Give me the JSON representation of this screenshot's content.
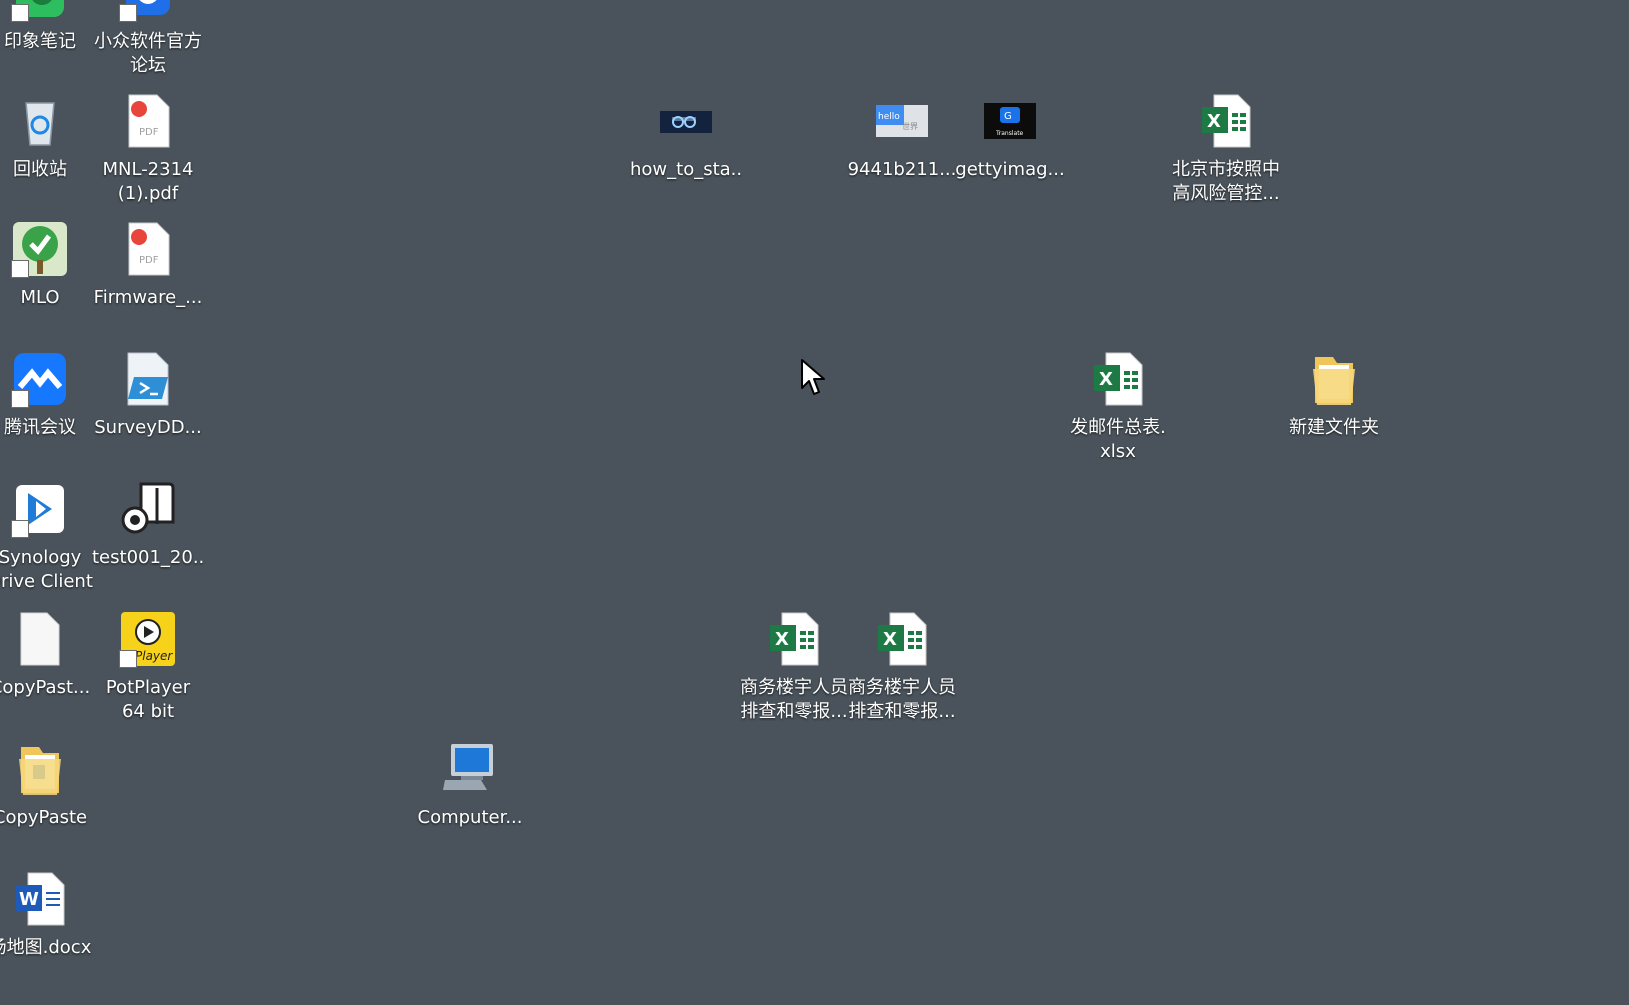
{
  "desktop": {
    "background_color": "#4a535b",
    "icons": [
      {
        "label": "印象笔记",
        "icon": "evernote-app-icon",
        "shortcut": true
      },
      {
        "label": "小众软件官方\n论坛",
        "icon": "browser-app-icon",
        "shortcut": true
      },
      {
        "label": "回收站",
        "icon": "recycle-bin-icon",
        "shortcut": false
      },
      {
        "label": "MNL-2314\n(1).pdf",
        "icon": "pdf-file-icon",
        "shortcut": false
      },
      {
        "label": "MLO",
        "icon": "mlo-app-icon",
        "shortcut": true
      },
      {
        "label": "Firmware_...",
        "icon": "pdf-file-icon",
        "shortcut": false
      },
      {
        "label": "腾讯会议",
        "icon": "tencent-meeting-icon",
        "shortcut": true
      },
      {
        "label": "SurveyDD...",
        "icon": "powershell-script-icon",
        "shortcut": false
      },
      {
        "label": "Synology\nDrive Client",
        "icon": "synology-drive-icon",
        "shortcut": true
      },
      {
        "label": "test001_20...",
        "icon": "audio-file-icon",
        "shortcut": false
      },
      {
        "label": "CopyPast...",
        "icon": "blank-file-icon",
        "shortcut": false
      },
      {
        "label": "PotPlayer\n64 bit",
        "icon": "potplayer-icon",
        "shortcut": true
      },
      {
        "label": "CopyPaste",
        "icon": "folder-icon",
        "shortcut": false
      },
      {
        "label": "场地图.docx",
        "icon": "word-document-icon",
        "shortcut": false
      },
      {
        "label": "Computer...",
        "icon": "computer-icon",
        "shortcut": false
      },
      {
        "label": "how_to_sta...",
        "icon": "image-thumbnail-icon",
        "shortcut": false
      },
      {
        "label": "9441b211...",
        "icon": "image-thumbnail-icon",
        "shortcut": false
      },
      {
        "label": "gettyimag...",
        "icon": "image-thumbnail-icon",
        "shortcut": false
      },
      {
        "label": "北京市按照中\n高风险管控...",
        "icon": "excel-file-icon",
        "shortcut": false
      },
      {
        "label": "发邮件总表.\nxlsx",
        "icon": "excel-file-icon",
        "shortcut": false
      },
      {
        "label": "新建文件夹",
        "icon": "folder-icon",
        "shortcut": false
      },
      {
        "label": "商务楼宇人员\n排查和零报...",
        "icon": "excel-file-icon",
        "shortcut": false
      },
      {
        "label": "商务楼宇人员\n排查和零报...",
        "icon": "excel-file-icon",
        "shortcut": false
      }
    ],
    "thumbnail_texts": {
      "hello_text": "hello",
      "world_text": "世界",
      "translate_text": "Translate",
      "player_text": "Player"
    },
    "cursor": "mouse-pointer-icon"
  }
}
